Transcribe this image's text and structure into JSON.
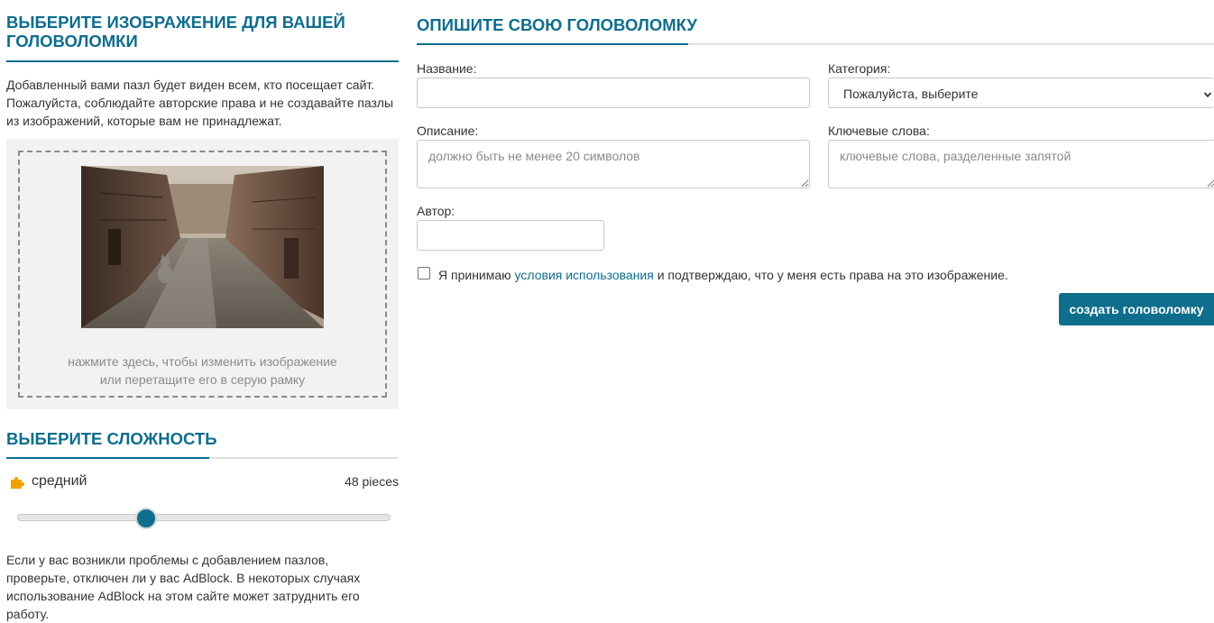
{
  "image_section": {
    "title": "ВЫБЕРИТЕ ИЗОБРАЖЕНИЕ ДЛЯ ВАШЕЙ ГОЛОВОЛОМКИ",
    "intro": "Добавленный вами пазл будет виден всем, кто посещает сайт. Пожалуйста, соблюдайте авторские права и не создавайте пазлы из изображений, которые вам не принадлежат.",
    "drop_hint_line1": "нажмите здесь, чтобы изменить изображение",
    "drop_hint_line2": "или перетащите его в серую рамку"
  },
  "difficulty_section": {
    "title": "ВЫБЕРИТЕ СЛОЖНОСТЬ",
    "level_label": "средний",
    "pieces_text": "48 pieces",
    "slider_level": 0.3,
    "icon": "puzzle-piece-icon",
    "icon_color": "#f0a300"
  },
  "adblock_note": "Если у вас возникли проблемы с добавлением пазлов, проверьте, отключен ли у вас AdBlock. В некоторых случаях использование AdBlock на этом сайте может затруднить его работу.",
  "describe_section": {
    "title": "ОПИШИТЕ СВОЮ ГОЛОВОЛОМКУ",
    "name_label": "Название:",
    "name_value": "",
    "category_label": "Категория:",
    "category_selected": "Пожалуйста, выберите",
    "description_label": "Описание:",
    "description_placeholder": "должно быть не менее 20 символов",
    "keywords_label": "Ключевые слова:",
    "keywords_placeholder": "ключевые слова, разделенные запятой",
    "author_label": "Автор:",
    "author_value": "",
    "terms_prefix": "Я принимаю ",
    "terms_link": "условия использования",
    "terms_suffix": " и подтверждаю, что у меня есть права на это изображение.",
    "terms_checked": false,
    "submit_label": "создать головоломку"
  },
  "colors": {
    "accent": "#0e6e8c",
    "title_line": "#e0e0e0",
    "drop_area_bg": "#f2f2f2"
  }
}
